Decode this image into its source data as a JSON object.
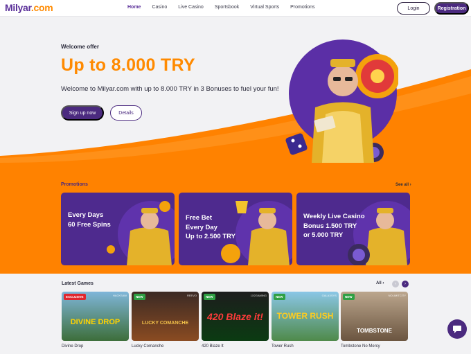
{
  "brand": {
    "logo_text": "Milyar",
    "logo_suffix": ".com",
    "primary": "#4b2a7f",
    "accent": "#ff8a00"
  },
  "nav": {
    "items": [
      {
        "label": "Home",
        "active": true
      },
      {
        "label": "Casino"
      },
      {
        "label": "Live Casino"
      },
      {
        "label": "Sportsbook"
      },
      {
        "label": "Virtual Sports"
      },
      {
        "label": "Promotions"
      }
    ],
    "login_label": "Login",
    "register_label": "Registration"
  },
  "hero": {
    "eyebrow": "Welcome offer",
    "headline": "Up to 8.000 TRY",
    "description": "Welcome to Milyar.com with up to 8.000 TRY in 3 Bonuses to fuel your fun!",
    "signup_label": "Sign up now",
    "details_label": "Details"
  },
  "promotions": {
    "title": "Promotions",
    "see_all": "See all ›",
    "cards": [
      {
        "text": "Every Days\n60 Free Spins"
      },
      {
        "text": "Free Bet\nEvery Day\nUp to 2.500 TRY"
      },
      {
        "text": "Weekly Live Casino\nBonus 1.500 TRY\nor 5.000 TRY"
      }
    ]
  },
  "latest_games": {
    "title": "Latest Games",
    "all_link": "All ›",
    "games": [
      {
        "name": "Divine Drop",
        "badge": "EXCLUSIVE",
        "provider": "HACKSAW",
        "art_title": "DIVINE DROP"
      },
      {
        "name": "Lucky Comanche",
        "badge": "NEW",
        "provider": "REEVO",
        "art_title": "LUCKY COMANCHE"
      },
      {
        "name": "420 Blaze It",
        "badge": "NEW",
        "provider": "1X2GAMING",
        "art_title": "420 Blaze it!"
      },
      {
        "name": "Tower Rush",
        "badge": "NEW",
        "provider": "GALAXSYS",
        "art_title": "TOWER RUSH"
      },
      {
        "name": "Tombstone No Mercy",
        "badge": "NEW",
        "provider": "NOLIMITCITY",
        "art_title": "TOMBSTONE"
      }
    ]
  },
  "chat": {
    "icon": "chat-bubble-icon"
  }
}
